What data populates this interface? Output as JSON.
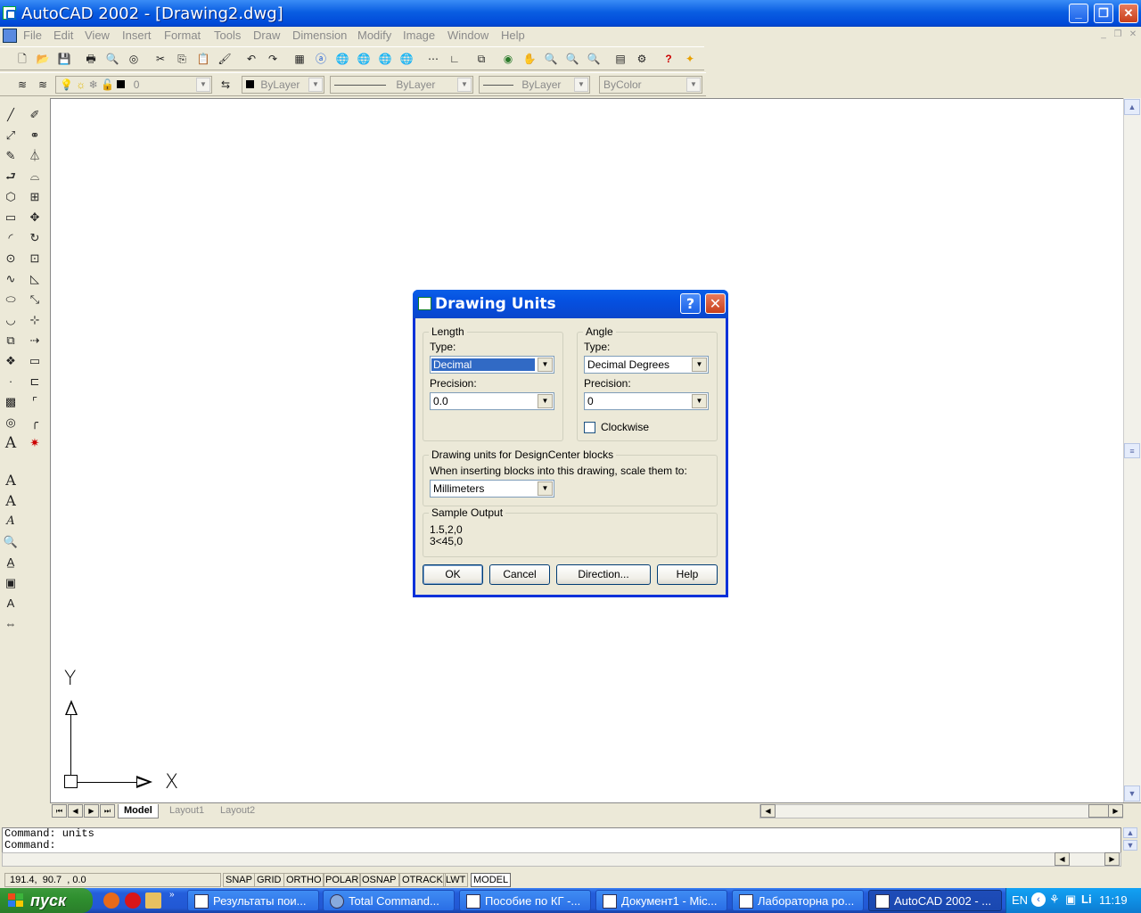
{
  "window": {
    "title": "AutoCAD 2002 - [Drawing2.dwg]"
  },
  "menu": [
    "File",
    "Edit",
    "View",
    "Insert",
    "Format",
    "Tools",
    "Draw",
    "Dimension",
    "Modify",
    "Image",
    "Window",
    "Help"
  ],
  "properties_toolbar": {
    "layer_value": "0",
    "color_value": "ByLayer",
    "linetype_value": "ByLayer",
    "lineweight_value": "ByLayer",
    "plotstyle_value": "ByColor"
  },
  "tabs": [
    "Model",
    "Layout1",
    "Layout2"
  ],
  "command_lines": [
    "Command: units",
    "Command:"
  ],
  "status": {
    "coords": "191.4,  90.7  , 0.0",
    "buttons": [
      "SNAP",
      "GRID",
      "ORTHO",
      "POLAR",
      "OSNAP",
      "OTRACK",
      "LWT",
      "MODEL"
    ]
  },
  "ucs": {
    "x_label": "X",
    "y_label": "Y"
  },
  "dialog": {
    "title": "Drawing Units",
    "help_glyph": "?",
    "length": {
      "group": "Length",
      "type_label": "Type:",
      "type_value": "Decimal",
      "precision_label": "Precision:",
      "precision_value": "0.0"
    },
    "angle": {
      "group": "Angle",
      "type_label": "Type:",
      "type_value": "Decimal Degrees",
      "precision_label": "Precision:",
      "precision_value": "0",
      "clockwise_label": "Clockwise",
      "clockwise_checked": false
    },
    "designcenter": {
      "group": "Drawing units for DesignCenter blocks",
      "prompt": "When inserting blocks into this drawing, scale them to:",
      "value": "Millimeters"
    },
    "sample": {
      "group": "Sample Output",
      "line1": "1.5,2,0",
      "line2": "3<45,0"
    },
    "buttons": {
      "ok": "OK",
      "cancel": "Cancel",
      "direction": "Direction...",
      "help": "Help"
    }
  },
  "taskbar": {
    "start": "пуск",
    "tasks": [
      "Результаты пои...",
      "Total Command...",
      "Пособие по КГ -...",
      "Документ1 - Mic...",
      "Лабораторна ро...",
      "AutoCAD 2002 - ..."
    ],
    "lang": "EN",
    "clock": "11:19"
  }
}
